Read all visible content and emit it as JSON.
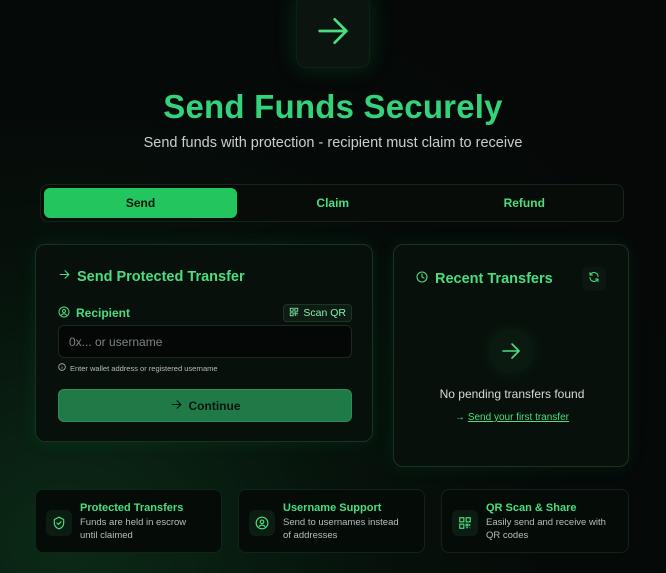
{
  "hero": {
    "icon": "arrow-right-icon",
    "title": "Send Funds Securely",
    "subtitle": "Send funds with protection - recipient must claim to receive"
  },
  "tabs": [
    {
      "label": "Send",
      "active": true
    },
    {
      "label": "Claim",
      "active": false
    },
    {
      "label": "Refund",
      "active": false
    }
  ],
  "send_card": {
    "title": "Send Protected Transfer",
    "recipient_label": "Recipient",
    "scan_label": "Scan QR",
    "input_value": "",
    "input_placeholder": "0x... or username",
    "hint": "Enter wallet address or registered username",
    "continue_label": "Continue"
  },
  "recent_card": {
    "title": "Recent Transfers",
    "empty_text": "No pending transfers found",
    "empty_link": "Send your first transfer"
  },
  "features": [
    {
      "title": "Protected Transfers",
      "desc_line1": "Funds are held in escrow",
      "desc_line2": "until claimed",
      "icon": "shield-check-icon"
    },
    {
      "title": "Username Support",
      "desc_line1": "Send to usernames instead",
      "desc_line2": "of addresses",
      "icon": "user-circle-icon"
    },
    {
      "title": "QR Scan & Share",
      "desc_line1": "Easily send and receive with",
      "desc_line2": "QR codes",
      "icon": "qr-code-icon"
    }
  ],
  "colors": {
    "accent": "#22c55e",
    "accent_text": "#4ade80",
    "background": "#050908"
  }
}
